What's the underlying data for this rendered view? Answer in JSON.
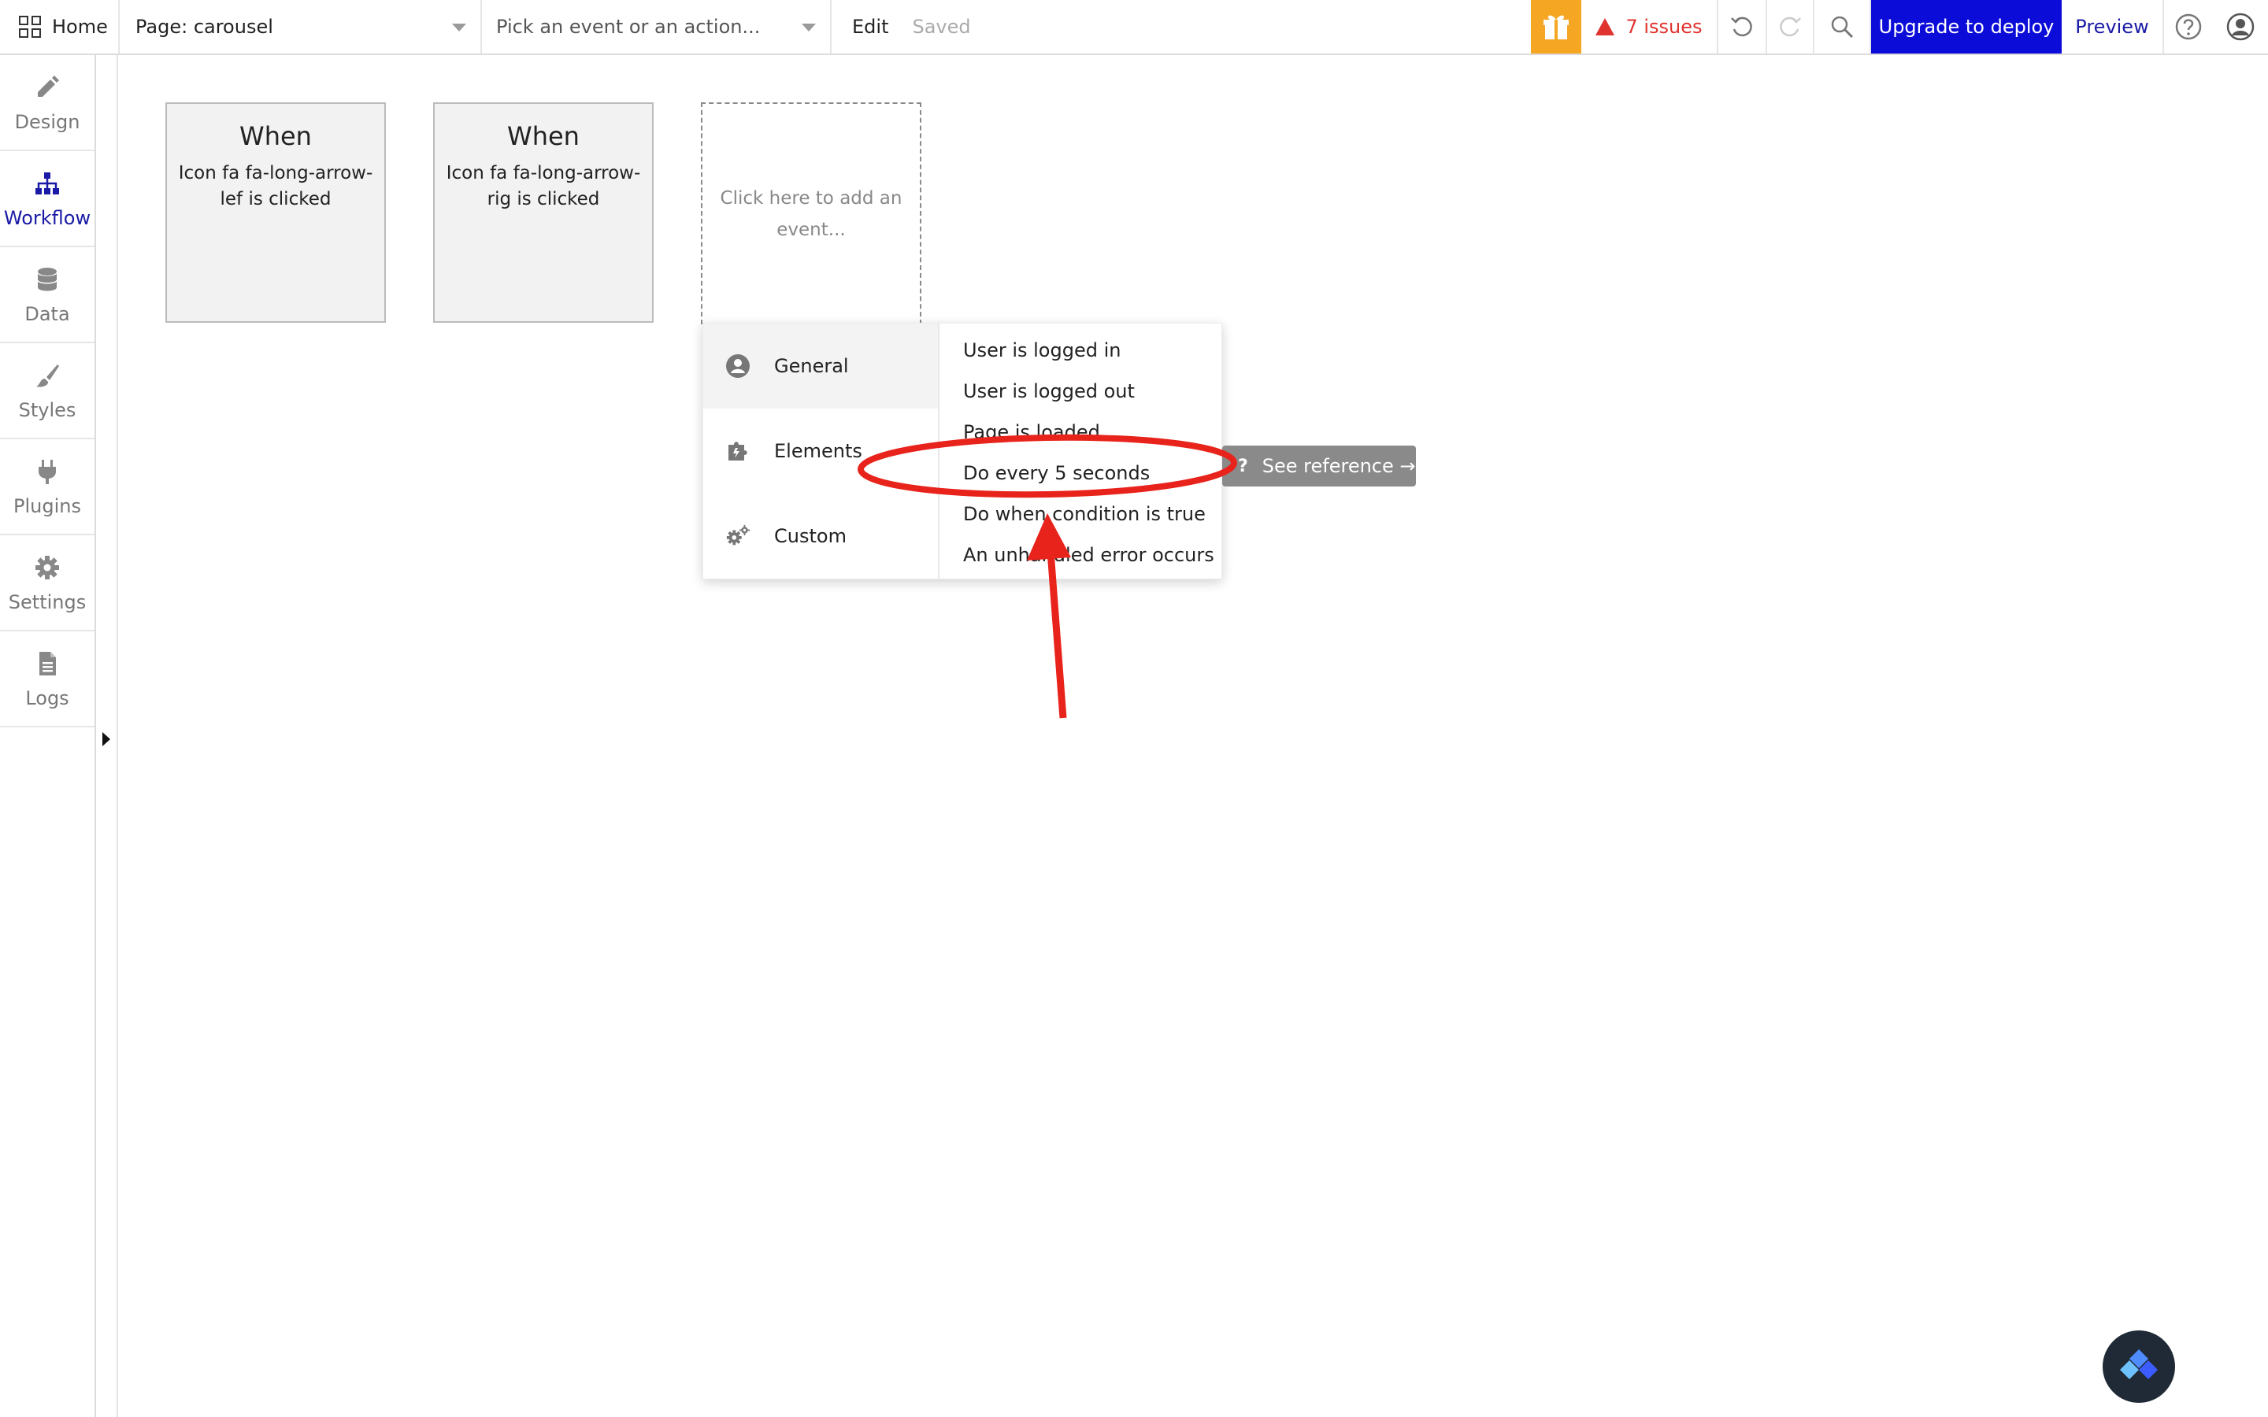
{
  "topbar": {
    "home_label": "Home",
    "page_label": "Page: carousel",
    "event_placeholder": "Pick an event or an action...",
    "edit_label": "Edit",
    "saved_label": "Saved",
    "issues_label": "7 issues",
    "upgrade_label": "Upgrade to deploy",
    "preview_label": "Preview"
  },
  "sidebar": {
    "items": [
      {
        "label": "Design",
        "icon": "design-icon"
      },
      {
        "label": "Workflow",
        "icon": "workflow-icon",
        "active": true
      },
      {
        "label": "Data",
        "icon": "database-icon"
      },
      {
        "label": "Styles",
        "icon": "brush-icon"
      },
      {
        "label": "Plugins",
        "icon": "plug-icon"
      },
      {
        "label": "Settings",
        "icon": "gear-icon"
      },
      {
        "label": "Logs",
        "icon": "document-icon"
      }
    ]
  },
  "cards": [
    {
      "title": "When",
      "desc": "Icon fa fa-long-arrow-lef is clicked"
    },
    {
      "title": "When",
      "desc": "Icon fa fa-long-arrow-rig is clicked"
    }
  ],
  "add_event": {
    "placeholder": "Click here to add an event..."
  },
  "dropdown": {
    "categories": [
      "General",
      "Elements",
      "Custom"
    ],
    "items": [
      "User is logged in",
      "User is logged out",
      "Page is loaded",
      "Do every 5 seconds",
      "Do when condition is true",
      "An unhandled error occurs"
    ]
  },
  "reference_tip": {
    "label": "See reference →"
  },
  "colors": {
    "accent": "#0b0cd8",
    "active_nav": "#1a1aa6",
    "issues": "#e0322f",
    "gift": "#f5a623",
    "annotation": "#e8231b"
  }
}
